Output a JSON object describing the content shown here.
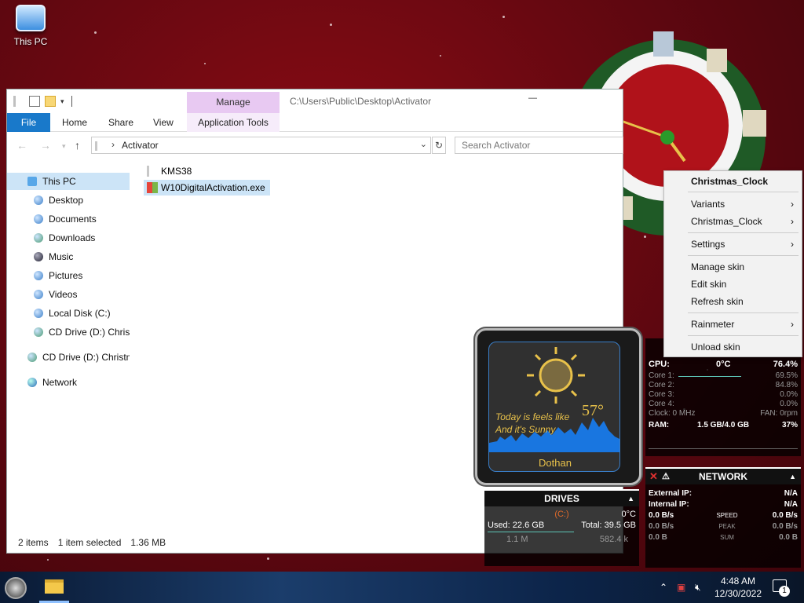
{
  "desktop": {
    "this_pc_label": "This PC"
  },
  "explorer": {
    "title_path": "C:\\Users\\Public\\Desktop\\Activator",
    "manage_tab": "Manage",
    "tabs": {
      "file": "File",
      "home": "Home",
      "share": "Share",
      "view": "View",
      "app_tools": "Application Tools"
    },
    "address": "Activator",
    "search_placeholder": "Search Activator",
    "nav": [
      "This PC",
      "Desktop",
      "Documents",
      "Downloads",
      "Music",
      "Pictures",
      "Videos",
      "Local Disk (C:)",
      "CD Drive (D:) Christ",
      "CD Drive (D:) Christm",
      "Network"
    ],
    "files": [
      "KMS38",
      "W10DigitalActivation.exe"
    ],
    "status": {
      "count": "2 items",
      "selection": "1 item selected",
      "size": "1.36 MB"
    }
  },
  "weather": {
    "line1": "Today is feels like",
    "line2": "And it's Sunny",
    "temp": "57°",
    "city": "Dothan"
  },
  "drives": {
    "title": "DRIVES",
    "drive": "(C:)",
    "temp": "0°C",
    "used": "Used: 22.6 GB",
    "total": "Total: 39.5 GB",
    "read": "1.1 M",
    "write": "582.4 k"
  },
  "cpu": {
    "label": "CPU:",
    "temp": "0°C",
    "total": "76.4%",
    "cores": [
      {
        "name": "Core 1:",
        "value": "69.5%"
      },
      {
        "name": "Core 2:",
        "value": "84.8%"
      },
      {
        "name": "Core 3:",
        "value": "0.0%"
      },
      {
        "name": "Core 4:",
        "value": "0.0%"
      }
    ],
    "clock": "Clock: 0 MHz",
    "fan": "FAN: 0rpm",
    "ram_label": "RAM:",
    "ram_value": "1.5 GB/4.0 GB",
    "ram_pct": "37%"
  },
  "network": {
    "title": "NETWORK",
    "ext_label": "External IP:",
    "ext_value": "N/A",
    "int_label": "Internal IP:",
    "int_value": "N/A",
    "rows": [
      {
        "left": "0.0 B/s",
        "mid": "SPEED",
        "right": "0.0 B/s"
      },
      {
        "left": "0.0 B/s",
        "mid": "PEAK",
        "right": "0.0 B/s"
      },
      {
        "left": "0.0 B",
        "mid": "SUM",
        "right": "0.0 B"
      }
    ]
  },
  "context_menu": {
    "title": "Christmas_Clock",
    "items": [
      "Variants",
      "Christmas_Clock",
      "Settings",
      "Manage skin",
      "Edit skin",
      "Refresh skin",
      "Rainmeter",
      "Unload skin"
    ]
  },
  "taskbar": {
    "time": "4:48 AM",
    "date": "12/30/2022",
    "notifications": "1"
  },
  "colors": {
    "accent": "#1979ca",
    "manage_tab": "#e8c9f2",
    "selection": "#cce4f7",
    "weather_text": "#e8c14a",
    "desktop_bg": "#6a0810"
  }
}
